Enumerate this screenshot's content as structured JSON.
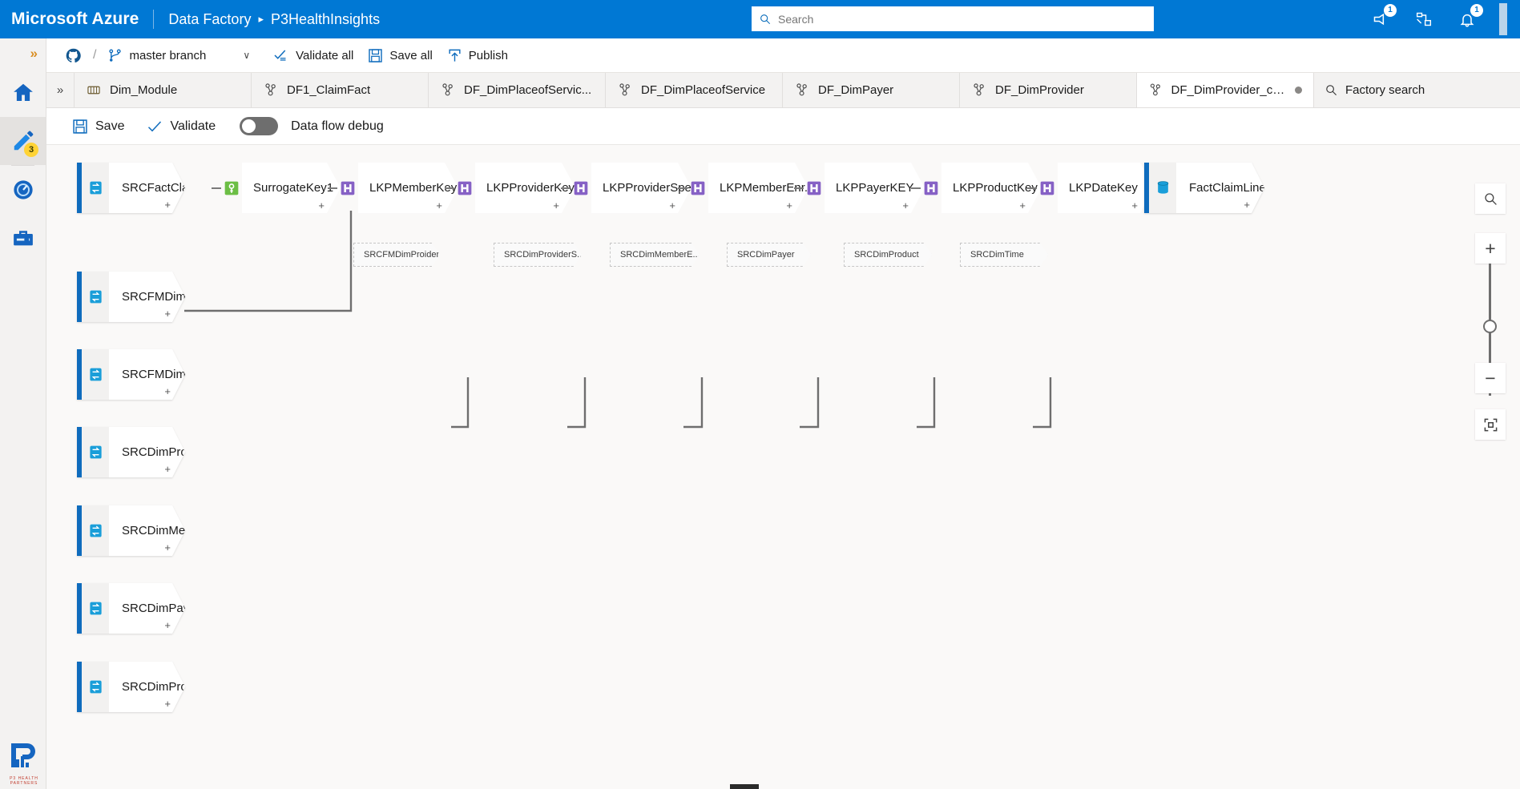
{
  "topbar": {
    "brand": "Microsoft Azure",
    "service": "Data Factory",
    "separator_arrow": "▸",
    "resource": "P3HealthInsights",
    "search_placeholder": "Search",
    "search_icon": "search-icon",
    "notify_count": "1",
    "alert_count": "1",
    "icons": [
      "feedback-icon",
      "cloud-shell-icon",
      "directory-icon",
      "notifications-icon"
    ]
  },
  "rail": {
    "expand_chevron": "»",
    "items": [
      {
        "name": "home",
        "icon": "home-icon",
        "badge": ""
      },
      {
        "name": "author",
        "icon": "pencil-icon",
        "badge": "3"
      },
      {
        "name": "monitor",
        "icon": "monitor-gauge-icon",
        "badge": ""
      },
      {
        "name": "manage",
        "icon": "toolbox-icon",
        "badge": ""
      }
    ],
    "logo_text": "P3 HEALTH\nPARTNERS"
  },
  "gitbar": {
    "repo_icon": "github-icon",
    "slash": "/",
    "branch_icon": "branch-icon",
    "branch_label": "master branch",
    "branch_chevron": "∨",
    "validate_all": "Validate all",
    "save_all": "Save all",
    "publish": "Publish",
    "validate_icon": "validate-check-icon",
    "save_icon": "save-disk-icon",
    "publish_icon": "publish-upload-icon"
  },
  "tabs": {
    "overflow_chevron": "»",
    "items": [
      {
        "label": "Dim_Module",
        "icon": "pipeline-icon",
        "active": false,
        "dirty": false
      },
      {
        "label": "DF1_ClaimFact",
        "icon": "dataflow-icon",
        "active": false,
        "dirty": false
      },
      {
        "label": "DF_DimPlaceofServic...",
        "icon": "dataflow-icon",
        "active": false,
        "dirty": false
      },
      {
        "label": "DF_DimPlaceofService",
        "icon": "dataflow-icon",
        "active": false,
        "dirty": false
      },
      {
        "label": "DF_DimPayer",
        "icon": "dataflow-icon",
        "active": false,
        "dirty": false
      },
      {
        "label": "DF_DimProvider",
        "icon": "dataflow-icon",
        "active": false,
        "dirty": false
      },
      {
        "label": "DF_DimProvider_cop...",
        "icon": "dataflow-icon",
        "active": true,
        "dirty": true
      }
    ],
    "factory_search": "Factory search",
    "factory_search_icon": "search-icon"
  },
  "dataflow_bar": {
    "save": "Save",
    "save_icon": "save-disk-icon",
    "validate": "Validate",
    "validate_icon": "check-icon",
    "debug_label": "Data flow debug",
    "debug_on": false
  },
  "canvas": {
    "main_chain": [
      {
        "label": "SRCFactClaimLi...",
        "kind": "source",
        "icon": "source-dataset-icon"
      },
      {
        "label": "SurrogateKey1",
        "kind": "surrogate",
        "icon": "surrogate-key-icon"
      },
      {
        "label": "LKPMemberKey",
        "kind": "lookup",
        "icon": "lookup-icon"
      },
      {
        "label": "LKPProviderKey",
        "kind": "lookup",
        "icon": "lookup-icon"
      },
      {
        "label": "LKPProviderSpe...",
        "kind": "lookup",
        "icon": "lookup-icon"
      },
      {
        "label": "LKPMemberEnr...",
        "kind": "lookup",
        "icon": "lookup-icon"
      },
      {
        "label": "LKPPayerKEY",
        "kind": "lookup",
        "icon": "lookup-icon"
      },
      {
        "label": "LKPProductKey",
        "kind": "lookup",
        "icon": "lookup-icon"
      },
      {
        "label": "LKPDateKey",
        "kind": "lookup",
        "icon": "lookup-icon"
      },
      {
        "label": "FactClaimLine",
        "kind": "sink",
        "icon": "sink-dataset-icon"
      }
    ],
    "lookup_inputs": [
      "SRCFMDimProider",
      "SRCDimProviderS...",
      "SRCDimMemberE...",
      "SRCDimPayer",
      "SRCDimProduct",
      "SRCDimTime"
    ],
    "sources": [
      "SRCFMDimMe...",
      "SRCFMDimProi...",
      "SRCDimProvide...",
      "SRCDimMembe...",
      "SRCDimPayer",
      "SRCDimProduct"
    ],
    "controls": {
      "search": "search-icon",
      "zoom_in": "+",
      "zoom_out": "−",
      "fit": "fit-to-screen-icon"
    }
  },
  "colors": {
    "azure_blue": "#0078d4",
    "source_accent": "#0f6cbd",
    "surrogate_green": "#6cbe45",
    "lookup_purple": "#8661c5",
    "sink_blue": "#1a9ed9"
  }
}
